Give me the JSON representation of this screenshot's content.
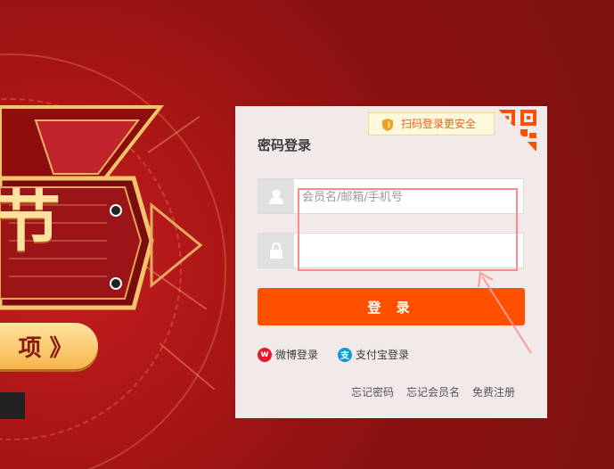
{
  "banner": {
    "big_text": "节",
    "button_text": "项 》"
  },
  "login_card": {
    "qr_tip_text": "扫码登录更安全",
    "title": "密码登录",
    "username": {
      "placeholder": "会员名/邮箱/手机号",
      "value": ""
    },
    "password": {
      "placeholder": "",
      "value": ""
    },
    "login_button": "登 录",
    "weibo_login": "微博登录",
    "alipay_login": "支付宝登录",
    "forgot_password": "忘记密码",
    "forgot_username": "忘记会员名",
    "free_register": "免费注册"
  },
  "colors": {
    "accent": "#ff5000",
    "background": "#8a1111",
    "card_bg": "#f2e9e9",
    "tip_text": "#e1651e",
    "annotation": "#ff8a8a"
  },
  "icons": {
    "shield": "shield-icon",
    "qr": "qr-code-icon",
    "user": "user-icon",
    "lock": "lock-icon",
    "weibo": "weibo-icon",
    "alipay": "alipay-icon"
  }
}
